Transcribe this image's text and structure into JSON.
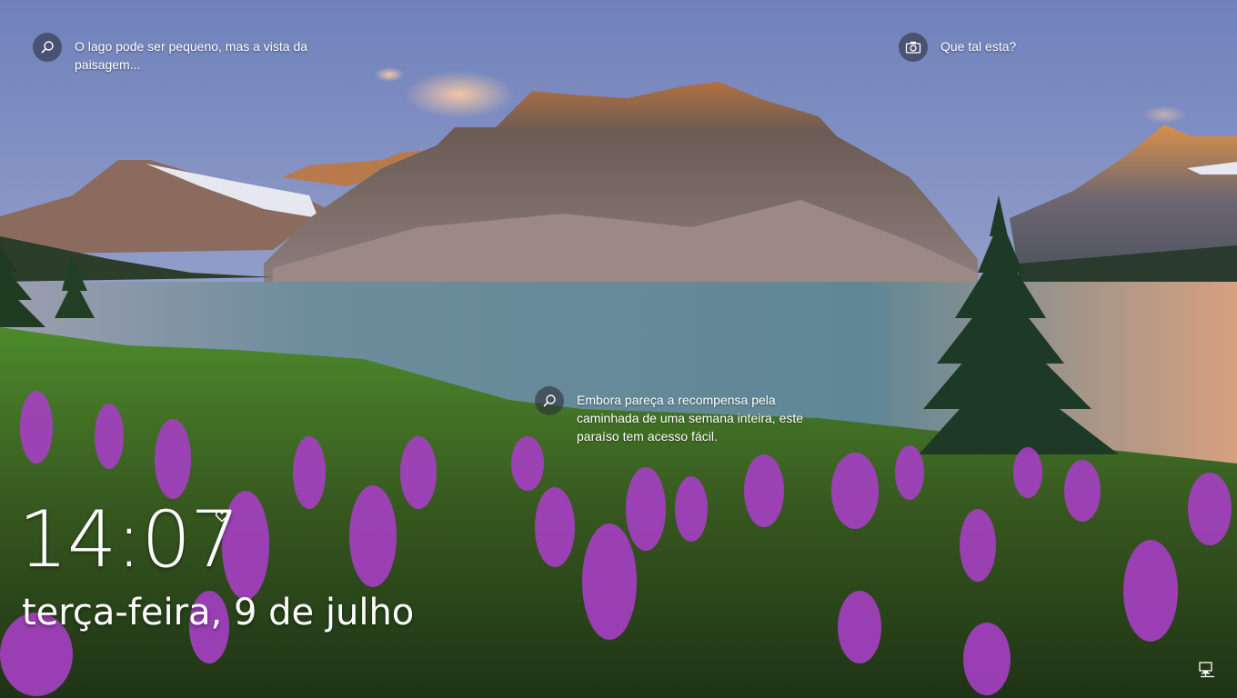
{
  "spotlight": {
    "top_left_hotspot": {
      "icon": "search-icon",
      "text": "O lago pode ser pequeno, mas a vista da\npaisagem..."
    },
    "top_right_hotspot": {
      "icon": "camera-icon",
      "text": "Que tal esta?"
    },
    "center_hotspot": {
      "icon": "search-icon",
      "text": "Embora pareça a recompensa pela\ncaminhada de uma semana inteira, este\nparaíso tem acesso fácil."
    }
  },
  "lockscreen": {
    "time": "14:07",
    "date": "terça-feira, 9 de julho",
    "status_icon": "heart-icon",
    "network_icon": "network-icon"
  },
  "colors": {
    "sky_top": "#7f8fc4",
    "sky_bottom": "#b9c4d8",
    "lake": "#6d8fa0",
    "meadow": "#3f6b25",
    "flowers": "#a33fc2"
  }
}
